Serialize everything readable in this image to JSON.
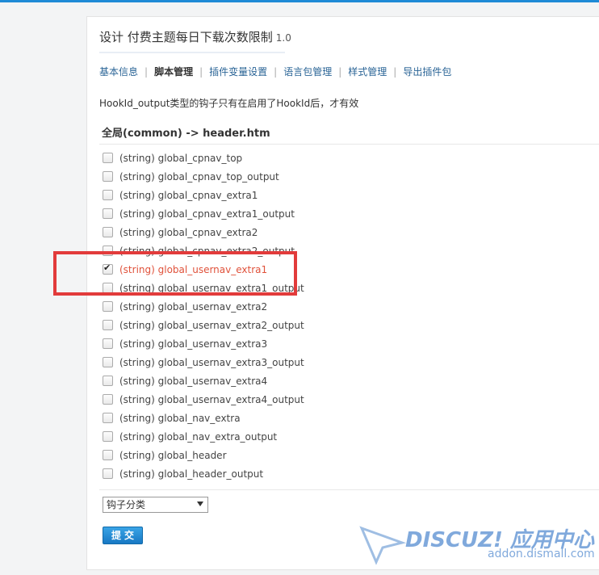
{
  "panel": {
    "title": "设计 付费主题每日下载次数限制",
    "version": "1.0"
  },
  "tabs": [
    {
      "label": "基本信息",
      "active": false
    },
    {
      "label": "脚本管理",
      "active": true
    },
    {
      "label": "插件变量设置",
      "active": false
    },
    {
      "label": "语言包管理",
      "active": false
    },
    {
      "label": "样式管理",
      "active": false
    },
    {
      "label": "导出插件包",
      "active": false
    }
  ],
  "tab_separator": "|",
  "notice": "HookId_output类型的钩子只有在启用了HookId后，才有效",
  "group": {
    "heading": "全局(common) -> header.htm"
  },
  "hooks": [
    {
      "label": "(string) global_cpnav_top",
      "checked": false
    },
    {
      "label": "(string) global_cpnav_top_output",
      "checked": false
    },
    {
      "label": "(string) global_cpnav_extra1",
      "checked": false
    },
    {
      "label": "(string) global_cpnav_extra1_output",
      "checked": false
    },
    {
      "label": "(string) global_cpnav_extra2",
      "checked": false
    },
    {
      "label": "(string) global_cpnav_extra2_output",
      "checked": false
    },
    {
      "label": "(string) global_usernav_extra1",
      "checked": true
    },
    {
      "label": "(string) global_usernav_extra1_output",
      "checked": false
    },
    {
      "label": "(string) global_usernav_extra2",
      "checked": false
    },
    {
      "label": "(string) global_usernav_extra2_output",
      "checked": false
    },
    {
      "label": "(string) global_usernav_extra3",
      "checked": false
    },
    {
      "label": "(string) global_usernav_extra3_output",
      "checked": false
    },
    {
      "label": "(string) global_usernav_extra4",
      "checked": false
    },
    {
      "label": "(string) global_usernav_extra4_output",
      "checked": false
    },
    {
      "label": "(string) global_nav_extra",
      "checked": false
    },
    {
      "label": "(string) global_nav_extra_output",
      "checked": false
    },
    {
      "label": "(string) global_header",
      "checked": false
    },
    {
      "label": "(string) global_header_output",
      "checked": false
    }
  ],
  "category_select": {
    "selected": "钩子分类"
  },
  "submit_label": "提交",
  "watermark": {
    "brand": "DISCUZ! 应用中心",
    "site": "addon.dismall.com"
  },
  "colors": {
    "accent_blue": "#1f8ad6",
    "checked_text": "#e0523b",
    "highlight_border": "#e23b3b",
    "tab_link": "#2a6496"
  }
}
